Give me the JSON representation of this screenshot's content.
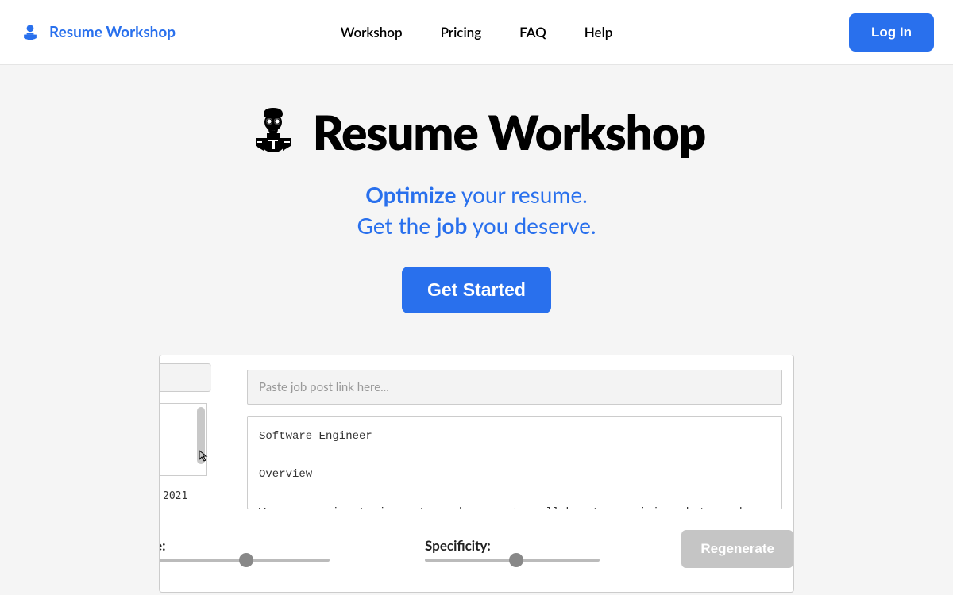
{
  "brand": {
    "name": "Resume Workshop"
  },
  "nav": {
    "items": [
      "Workshop",
      "Pricing",
      "FAQ",
      "Help"
    ],
    "login": "Log In"
  },
  "hero": {
    "title": "Resume Workshop",
    "tagline_optimize": "Optimize",
    "tagline_rest1": " your resume.",
    "tagline_getthe": "Get the ",
    "tagline_job": "job",
    "tagline_rest2": " you deserve.",
    "cta": "Get Started"
  },
  "preview": {
    "input_placeholder": "Paste job post link here...",
    "job_text": "Software Engineer\n\nOverview\n\nWe are passionate innovators who come to collaborate, envision what can be and take their careers further. This is a world of more possibilities, more",
    "date_fragment": "2021",
    "slider1_suffix": "e:",
    "slider2_label": "Specificity:",
    "regenerate": "Regenerate"
  },
  "colors": {
    "primary": "#2970ed"
  }
}
